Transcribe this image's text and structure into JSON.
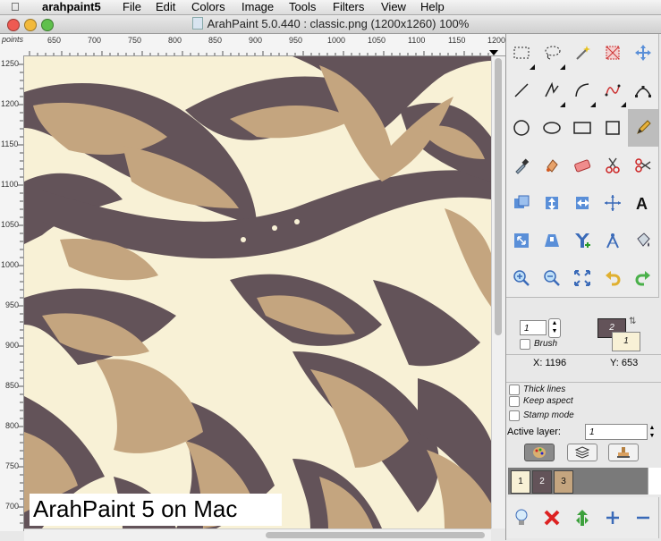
{
  "menubar": {
    "app": "arahpaint5",
    "items": [
      "File",
      "Edit",
      "Colors",
      "Image",
      "Tools",
      "Filters",
      "View",
      "Help"
    ]
  },
  "window": {
    "title": "ArahPaint 5.0.440 : classic.png  (1200x1260) 100%"
  },
  "ruler": {
    "units": "points",
    "h_ticks": [
      "650",
      "700",
      "750",
      "800",
      "850",
      "900",
      "950",
      "1000",
      "1050",
      "1100",
      "1150",
      "1200"
    ],
    "v_ticks": [
      "1250",
      "1200",
      "1150",
      "1100",
      "1050",
      "1000",
      "950",
      "900",
      "850",
      "800",
      "750",
      "700"
    ]
  },
  "tools": [
    "rect-select",
    "lasso",
    "magic-wand",
    "crop",
    "move",
    "line",
    "polyline",
    "arc",
    "curve",
    "bezier",
    "ellipse-circle",
    "ellipse",
    "rectangle",
    "square",
    "pencil",
    "eyedropper",
    "fill",
    "eraser",
    "cut",
    "cut-alt",
    "copy-layer",
    "flip",
    "rotate-layer",
    "transform",
    "text",
    "resize",
    "shape-warp",
    "merge-down",
    "compass",
    "fill-bucket",
    "zoom-in",
    "zoom-out",
    "fit",
    "undo",
    "redo"
  ],
  "brush": {
    "size": "1",
    "label": "Brush",
    "fg_color": "2",
    "bg_color": "1"
  },
  "coords": {
    "x_label": "X: 1196",
    "y_label": "Y: 653"
  },
  "options": {
    "thick_lines": "Thick lines",
    "keep_aspect": "Keep aspect",
    "stamp_mode": "Stamp mode",
    "active_layer_label": "Active layer:",
    "active_layer_value": "1"
  },
  "layers": [
    "1",
    "2",
    "3"
  ],
  "caption": "ArahPaint 5 on Mac",
  "colors": {
    "cream": "#f8f1d6",
    "tan": "#c4a57f",
    "dark": "#635359"
  }
}
